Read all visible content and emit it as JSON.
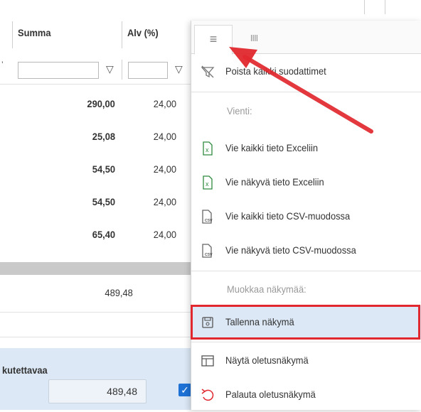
{
  "grid": {
    "headers": {
      "summa": "Summa",
      "alv": "Alv (%)"
    },
    "rows": [
      {
        "summa": "290,00",
        "alv": "24,00"
      },
      {
        "summa": "25,08",
        "alv": "24,00"
      },
      {
        "summa": "54,50",
        "alv": "24,00"
      },
      {
        "summa": "54,50",
        "alv": "24,00"
      },
      {
        "summa": "65,40",
        "alv": "24,00"
      }
    ],
    "total": "489,48",
    "bottom_label": "kutettavaa",
    "bottom_value": "489,48",
    "checkbox_checked": true
  },
  "menu": {
    "tabs": [
      {
        "name": "menu-tab",
        "icon": "hamburger-icon",
        "glyph": "≡"
      },
      {
        "name": "columns-tab",
        "icon": "columns-icon",
        "glyph": "IIII"
      }
    ],
    "items": {
      "clear_filters": "Poista kaikki suodattimet",
      "export_heading": "Vienti:",
      "export_all_excel": "Vie kaikki tieto Exceliin",
      "export_visible_excel": "Vie näkyvä tieto Exceliin",
      "export_all_csv": "Vie kaikki tieto CSV-muodossa",
      "export_visible_csv": "Vie näkyvä tieto CSV-muodossa",
      "edit_view_heading": "Muokkaa näkymää:",
      "save_view": "Tallenna näkymä",
      "show_default_view": "Näytä oletusnäkymä",
      "restore_default_view": "Palauta oletusnäkymä"
    },
    "icons": {
      "clear_filters": "filter-clear-icon",
      "excel": "excel-file-icon",
      "csv": "csv-file-icon",
      "save": "save-icon",
      "show_default": "table-layout-icon",
      "restore_default": "undo-icon"
    },
    "csv_glyph": "csv",
    "excel_glyph": "x"
  },
  "colors": {
    "highlight_border": "#e0282e",
    "selected_row": "#dce8f6",
    "arrow": "#e0282e",
    "checkbox": "#1e72d6"
  }
}
